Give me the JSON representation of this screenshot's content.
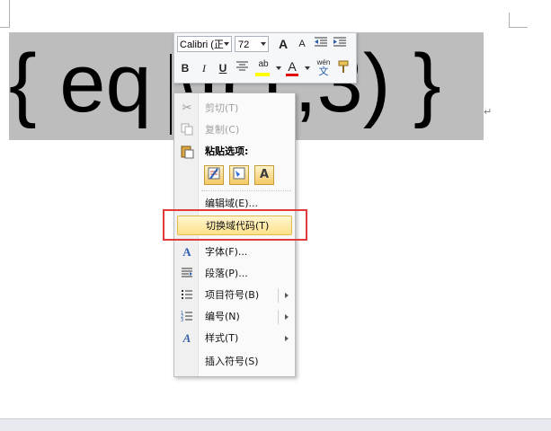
{
  "document": {
    "field_text": "{ eq \\f(1,3) }",
    "para_mark": "↵"
  },
  "mini_toolbar": {
    "font_name": "Calibri (正",
    "font_size": "72",
    "buttons": {
      "grow": "A",
      "shrink": "A",
      "bold": "B",
      "italic": "I",
      "underline": "U",
      "highlight": "ab",
      "font_color": "A",
      "phonetic": "wén"
    }
  },
  "context_menu": {
    "items": [
      {
        "label": "剪切(T)",
        "icon": "scissors-icon",
        "disabled": true
      },
      {
        "label": "复制(C)",
        "icon": "copy-icon",
        "disabled": true
      },
      {
        "label": "粘贴选项:",
        "icon": "paste-icon",
        "header": true
      },
      {
        "label": "编辑域(E)..."
      },
      {
        "label": "切换域代码(T)",
        "highlighted": true
      },
      {
        "label": "字体(F)...",
        "icon": "font-icon"
      },
      {
        "label": "段落(P)...",
        "icon": "paragraph-icon"
      },
      {
        "label": "项目符号(B)",
        "icon": "bullets-icon",
        "submenu": true
      },
      {
        "label": "编号(N)",
        "icon": "numbering-icon",
        "submenu": true
      },
      {
        "label": "样式(T)",
        "icon": "styles-icon",
        "submenu": true
      },
      {
        "label": "插入符号(S)"
      }
    ],
    "paste_options": [
      "",
      "",
      "A"
    ]
  },
  "colors": {
    "field_shading": "#bdbdbd",
    "highlight_red_frame": "#e23a3a",
    "menu_highlight": "#fde28b"
  }
}
